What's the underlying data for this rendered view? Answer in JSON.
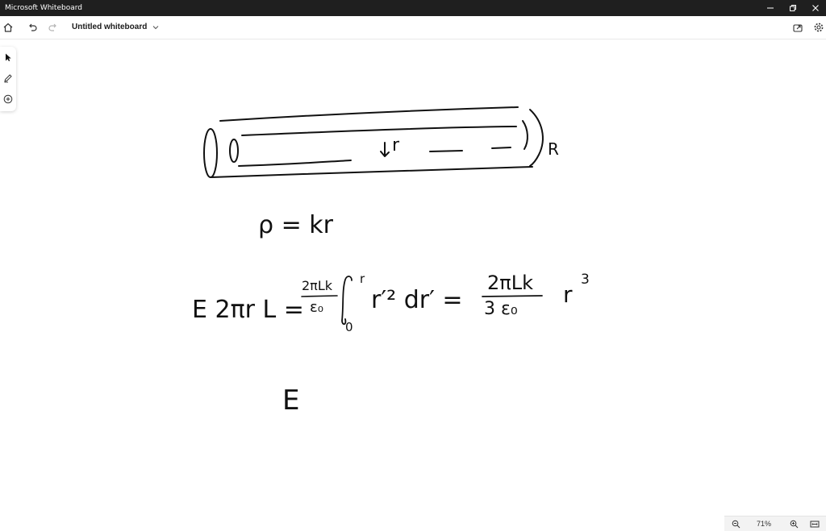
{
  "window": {
    "app_title": "Microsoft Whiteboard"
  },
  "toolbar": {
    "board_title": "Untitled whiteboard"
  },
  "zoom": {
    "level": "71%"
  },
  "ink": {
    "cylinder_arrow": "r",
    "cylinder_R": "R",
    "rho_eq": "ρ = kr",
    "gauss_lhs": "E 2πr L =",
    "frac1_num": "2πLk",
    "frac1_den": "ε₀",
    "integral_upper": "r",
    "integral_lower": "0",
    "integrand": "r′² dr′ =",
    "frac2_num": "2πLk",
    "frac2_den": "3 ε₀",
    "r_cubed_base": "r",
    "r_cubed_exp": "3",
    "bottom_E": "E"
  },
  "colors": {
    "titlebar": "#1f1f1f",
    "ink": "#111111",
    "canvas": "#ffffff"
  }
}
